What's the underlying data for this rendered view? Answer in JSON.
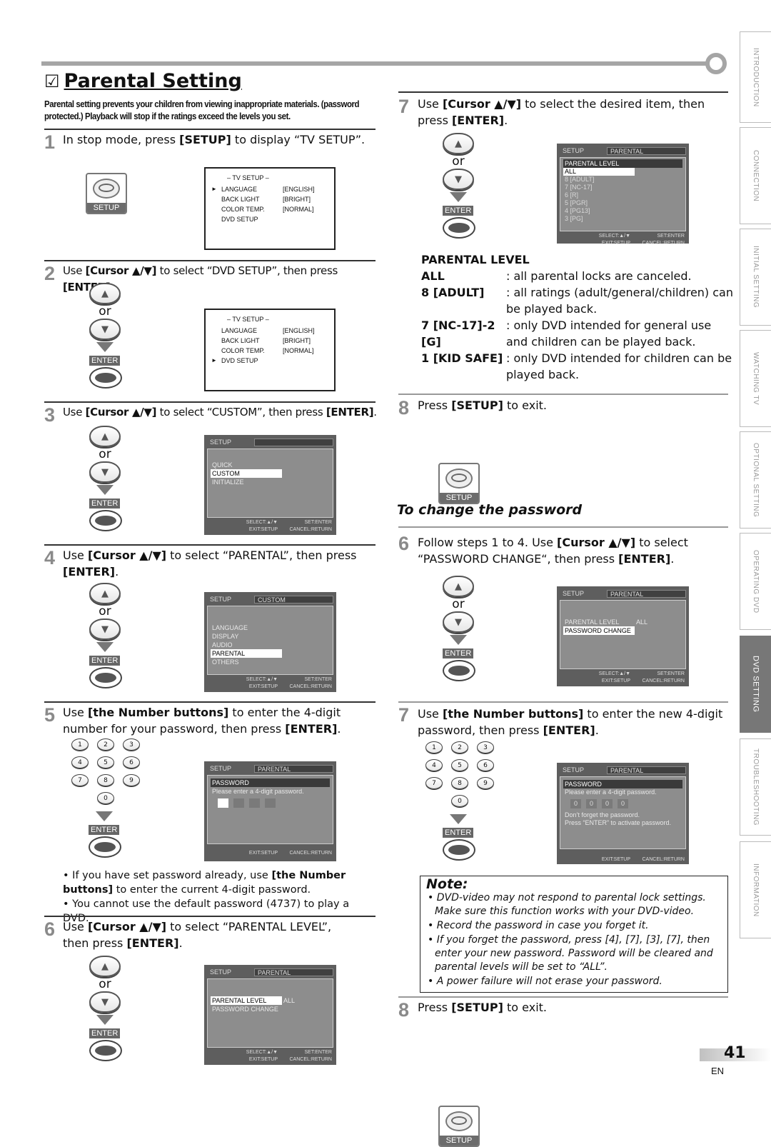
{
  "title": "Parental Setting",
  "title_check_icon": "checkbox-icon",
  "intro": "Parental setting prevents your children from viewing inappropriate materials. (password protected.) Playback will stop if the ratings exceed the levels you set.",
  "common": {
    "or": "or",
    "enter": "ENTER",
    "setup": "SETUP",
    "up": "▲",
    "down": "▼",
    "select_hint": "SELECT:▲/▼",
    "set_hint": "SET:ENTER",
    "exit_hint": "EXIT:SETUP",
    "cancel_hint": "CANCEL:RETURN"
  },
  "steps_left": [
    {
      "num": "1",
      "pre": "In stop mode, press ",
      "key": "[SETUP]",
      "post": " to display “TV SETUP”."
    },
    {
      "num": "2",
      "pre": "Use ",
      "key": "[Cursor ▲/▼]",
      "post": " to select “DVD SETUP”, then press ",
      "key2": "[ENTER]",
      "post2": "."
    },
    {
      "num": "3",
      "pre": "Use ",
      "key": "[Cursor ▲/▼]",
      "post": " to select “CUSTOM”, then press ",
      "key2": "[ENTER]",
      "post2": "."
    },
    {
      "num": "4",
      "pre": "Use ",
      "key": "[Cursor ▲/▼]",
      "post": " to select “PARENTAL”, then press ",
      "key2": "[ENTER]",
      "post2": "."
    },
    {
      "num": "5",
      "pre": "Use ",
      "key": "[the Number buttons]",
      "post": " to enter the 4-digit number for your password, then press ",
      "key2": "[ENTER]",
      "post2": "."
    },
    {
      "num": "6",
      "pre": "Use ",
      "key": "[Cursor ▲/▼]",
      "post": " to select “PARENTAL LEVEL”, then press ",
      "key2": "[ENTER]",
      "post2": "."
    }
  ],
  "tv_setup": {
    "header": "– TV SETUP –",
    "rows": [
      {
        "label": "LANGUAGE",
        "value": "[ENGLISH]"
      },
      {
        "label": "BACK LIGHT",
        "value": "[BRIGHT]"
      },
      {
        "label": "COLOR TEMP.",
        "value": "[NORMAL]"
      },
      {
        "label": "DVD SETUP",
        "value": ""
      }
    ],
    "pointer": "►"
  },
  "osd_setup": {
    "head": "SETUP",
    "tab": "",
    "items": [
      "QUICK",
      "CUSTOM",
      "INITIALIZE"
    ],
    "selected": 1
  },
  "osd_custom": {
    "head": "SETUP",
    "tab": "CUSTOM",
    "items": [
      "LANGUAGE",
      "DISPLAY",
      "AUDIO",
      "PARENTAL",
      "OTHERS"
    ],
    "selected": 3
  },
  "osd_password": {
    "head": "SETUP",
    "tab": "PARENTAL",
    "bar": "PASSWORD",
    "prompt": "Please enter a 4-digit password."
  },
  "osd_parental_menu": {
    "head": "SETUP",
    "tab": "PARENTAL",
    "level_label": "PARENTAL LEVEL",
    "level_value": "ALL",
    "change_label": "PASSWORD CHANGE"
  },
  "numpad": [
    "1",
    "2",
    "3",
    "4",
    "5",
    "6",
    "7",
    "8",
    "9",
    "0"
  ],
  "bullets_left": [
    {
      "pre": "If you have set password already, use ",
      "key": "[the Number buttons]",
      "post": " to enter the current 4-digit password."
    },
    {
      "pre": "You cannot use the default password (4737) to play a DVD.",
      "key": "",
      "post": ""
    }
  ],
  "step7": {
    "num": "7",
    "pre": "Use ",
    "key": "[Cursor ▲/▼]",
    "post": " to select the desired item, then press ",
    "key2": "[ENTER]",
    "post2": "."
  },
  "osd_levels": {
    "head": "SETUP",
    "tab": "PARENTAL",
    "bar": "PARENTAL LEVEL",
    "items": [
      "ALL",
      "8 [ADULT]",
      "7 [NC-17]",
      "6 [R]",
      "5 [PGR]",
      "4 [PG13]",
      "3 [PG]"
    ],
    "selected": 0
  },
  "parental_level": {
    "heading": "PARENTAL LEVEL",
    "rows": [
      {
        "key": "ALL",
        "desc": ": all parental locks are canceled."
      },
      {
        "key": "8 [ADULT]",
        "desc": ": all ratings (adult/general/children) can be played back."
      },
      {
        "key": "7 [NC-17]-2 [G]",
        "desc": ": only DVD intended for general use and children can be played back."
      },
      {
        "key": "1 [KID SAFE]",
        "desc": ": only DVD intended for children can be played back."
      }
    ]
  },
  "step8": {
    "num": "8",
    "pre": "Press ",
    "key": "[SETUP]",
    "post": " to exit."
  },
  "change_password": {
    "heading": "To change the password",
    "step6": {
      "num": "6",
      "pre": "Follow steps 1 to 4. Use ",
      "key": "[Cursor ▲/▼]",
      "post": " to select “PASSWORD CHANGE“, then press ",
      "key2": "[ENTER]",
      "post2": "."
    },
    "step7": {
      "num": "7",
      "pre": "Use ",
      "key": "[the Number buttons]",
      "post": " to enter the new 4-digit password, then press ",
      "key2": "[ENTER]",
      "post2": "."
    },
    "step8": {
      "num": "8",
      "pre": "Press ",
      "key": "[SETUP]",
      "post": " to exit."
    }
  },
  "osd_newpw": {
    "head": "SETUP",
    "tab": "PARENTAL",
    "bar": "PASSWORD",
    "prompt": "Please enter a 4-digit password.",
    "digits": [
      "0",
      "0",
      "0",
      "0"
    ],
    "msg1": "Don’t forget the password.",
    "msg2": "Press “ENTER” to activate password."
  },
  "note": {
    "title": "Note:",
    "items": [
      "DVD-video may not respond to parental lock settings. Make sure this function works with your DVD-video.",
      "Record the password in case you forget it.",
      "If you forget the password, press [4], [7], [3], [7], then enter your new password. Password will be cleared and parental levels will be set to “ALL”.",
      "A power failure will not erase your password."
    ]
  },
  "side_tabs": [
    {
      "label": "INTRODUCTION",
      "active": false
    },
    {
      "label": "CONNECTION",
      "active": false
    },
    {
      "label": "INITIAL  SETTING",
      "active": false
    },
    {
      "label": "WATCHING  TV",
      "active": false
    },
    {
      "label": "OPTIONAL  SETTING",
      "active": false
    },
    {
      "label": "OPERATING  DVD",
      "active": false
    },
    {
      "label": "DVD  SETTING",
      "active": true
    },
    {
      "label": "TROUBLESHOOTING",
      "active": false
    },
    {
      "label": "INFORMATION",
      "active": false
    }
  ],
  "page_number": "41",
  "language": "EN"
}
